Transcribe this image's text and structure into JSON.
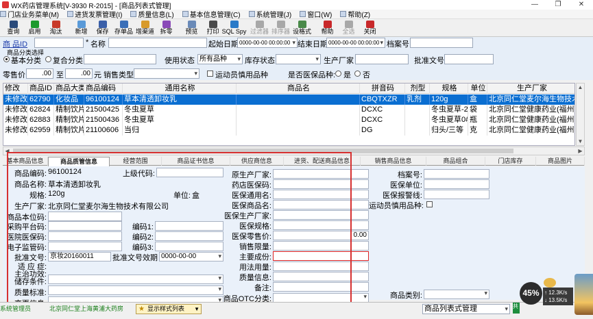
{
  "window": {
    "title": "WX药店管理系统[V-3930 R-2015] - [商品列表式管理]",
    "controls": [
      "—",
      "❐",
      "✕"
    ]
  },
  "menu": [
    "门店业务菜单(M)",
    "进货发票管理(I)",
    "质量信息(L)",
    "基本信息管理(C)",
    "系统管理(J)",
    "窗口(W)",
    "帮助(Z)"
  ],
  "toolbar": [
    {
      "label": "查询",
      "icon": "binoculars-icon",
      "color": "#2a4a7a",
      "disabled": false
    },
    {
      "label": "启用",
      "icon": "play-icon",
      "color": "#1c9a2c",
      "disabled": false
    },
    {
      "label": "淘汰",
      "icon": "stop-icon",
      "color": "#c83a2a",
      "disabled": false
    },
    {
      "label": "新增",
      "icon": "add-icon",
      "color": "#5a9ad8",
      "disabled": false
    },
    {
      "label": "保存",
      "icon": "save-icon",
      "color": "#3a5fa8",
      "disabled": false
    },
    {
      "label": "存单品",
      "icon": "save-item-icon",
      "color": "#3a6fb8",
      "disabled": false
    },
    {
      "label": "增渠道",
      "icon": "channel-icon",
      "color": "#d89a2a",
      "disabled": false
    },
    {
      "label": "拆零",
      "icon": "split-icon",
      "color": "#8a4ab8",
      "disabled": false
    },
    {
      "label": "预览",
      "icon": "preview-icon",
      "color": "#6a8ab8",
      "disabled": false
    },
    {
      "label": "打印",
      "icon": "print-icon",
      "color": "#4a4a4a",
      "disabled": false
    },
    {
      "label": "SQL Spy",
      "icon": "sql-spy-icon",
      "color": "#2a7ac8",
      "disabled": false
    },
    {
      "label": "过滤器",
      "icon": "filter-icon",
      "color": "#a8a8a8",
      "disabled": true
    },
    {
      "label": "排序器",
      "icon": "sorter-icon",
      "color": "#a8a8a8",
      "disabled": true
    },
    {
      "label": "设格式",
      "icon": "format-icon",
      "color": "#4a8a4a",
      "disabled": false
    },
    {
      "label": "帮助",
      "icon": "help-icon",
      "color": "#c8282a",
      "disabled": false
    },
    {
      "label": "全选",
      "icon": "select-all-icon",
      "color": "#a8a8a8",
      "disabled": true
    },
    {
      "label": "关闭",
      "icon": "close-icon",
      "color": "#c8282a",
      "disabled": false
    }
  ],
  "filter": {
    "product_id_label": "商  品ID",
    "name_label": "名称",
    "start_date_label": "起始日期",
    "start_date": "0000-00-00 00:00:00",
    "end_date_label": "结束日期",
    "end_date": "0000-00-00 00:00:00",
    "archive_no_label": "档案号",
    "category_group_label": "商品分类选择",
    "basic_category": "基本分类",
    "compound_category": "复合分类",
    "usage_status_label": "使用状态",
    "usage_status": "所有品种",
    "stock_status_label": "库存状态",
    "manufacturer_label": "生产厂家",
    "approval_label": "批准文号",
    "retail_price_label": "零售价",
    "price_from": ".00",
    "to_label": "至",
    "price_to": ".00",
    "currency": "元",
    "sales_type_label": "销售类型",
    "athlete_label": "运动员慎用品种",
    "insurance_label": "是否医保品种:",
    "yes_label": "是",
    "no_label": "否"
  },
  "grid": {
    "columns": [
      "修改",
      "商品ID",
      "商品大类",
      "商品编码",
      "通用名称",
      "商品名",
      "拼音码",
      "剂型",
      "规格",
      "单位",
      "生产厂家"
    ],
    "rows": [
      [
        "未修改",
        "62790",
        "化妆品",
        "96100124",
        "草本清透卸妆乳",
        "",
        "CBQTXZR",
        "乳剂",
        "120g",
        "盒",
        "北京同仁堂麦尔海生物技术有"
      ],
      [
        "未修改",
        "62824",
        "精制饮片",
        "21500425",
        "冬虫夏草",
        "",
        "DCXC",
        "",
        "冬虫夏草-2号",
        "袋",
        "北京同仁堂健康药业(福州)有"
      ],
      [
        "未修改",
        "62883",
        "精制饮片",
        "21500436",
        "冬虫夏草",
        "",
        "DCXC",
        "",
        "冬虫夏草0#-瓶",
        "瓶",
        "北京同仁堂健康药业(福州)有"
      ],
      [
        "未修改",
        "62959",
        "精制饮片",
        "21100606",
        "当归",
        "",
        "DG",
        "",
        "归头/三等",
        "克",
        "北京同仁堂健康药业(福州)有"
      ]
    ]
  },
  "tabs": [
    "基本商品信息",
    "商品质管信息",
    "经营范围",
    "商品证书信息",
    "供应商信息",
    "进货、配送商品信息",
    "销售商品信息",
    "商品组合",
    "门店库存",
    "商品图片"
  ],
  "detail": {
    "code_label": "商品编码:",
    "code": "96100124",
    "parent_code_label": "上级代码:",
    "name_label": "商品名称:",
    "name": "草本清透卸妆乳",
    "spec_label": "规格:",
    "spec": "120g",
    "unit_label": "单位:",
    "unit": "盒",
    "manufacturer_label": "生产厂家:",
    "manufacturer": "北京同仁堂麦尔海生物技术有限公司",
    "local_code_label": "商品本位码:",
    "platform_code_label": "采购平台码:",
    "code1_label": "编码1:",
    "hospital_code_label": "医院医保码:",
    "code2_label": "编码2:",
    "e_code_label": "电子监管码:",
    "code3_label": "编码3:",
    "approval_label": "批准文号:",
    "approval": "京妆20160011",
    "approval_expiry_label": "批准文号效期",
    "approval_expiry": "0000-00-00",
    "indication_label": "适 应 症:",
    "main_func_label": "主治功效:",
    "storage_label": "储存条件:",
    "quality_std_label": "质量标准:",
    "change_info_label": "变更信息:",
    "orig_maker_label": "原生产厂家:",
    "pharmacy_ins_label": "药店医保码:",
    "ins_generic_label": "医保通用名:",
    "ins_name_label": "医保商品名:",
    "ins_maker_label": "医保生产厂家:",
    "ins_spec_label": "医保规格:",
    "ins_price_label": "医保零售价:",
    "ins_price": "0.00",
    "sales_limit_label": "销售限量:",
    "ingredients_label": "主要成份:",
    "dosage_label": "用法用量:",
    "quality_info_label": "质量信息:",
    "remarks_label": "备注:",
    "otc_label": "商品OTC分类:",
    "archive_label": "档案号:",
    "ins_unit_label": "医保单位:",
    "ins_warning_label": "医保报警线:",
    "athlete_label": "运动员慎用品种:",
    "category_label": "商品类别:"
  },
  "status": {
    "user": "系统管理员",
    "store": "北京同仁堂上海黄浦大药房",
    "view_button": "显示样式列表",
    "view_combo": "商品列表式管理",
    "badge": "45%",
    "up": "12.3K/s",
    "down": "13.5K/s",
    "strip": "共"
  }
}
